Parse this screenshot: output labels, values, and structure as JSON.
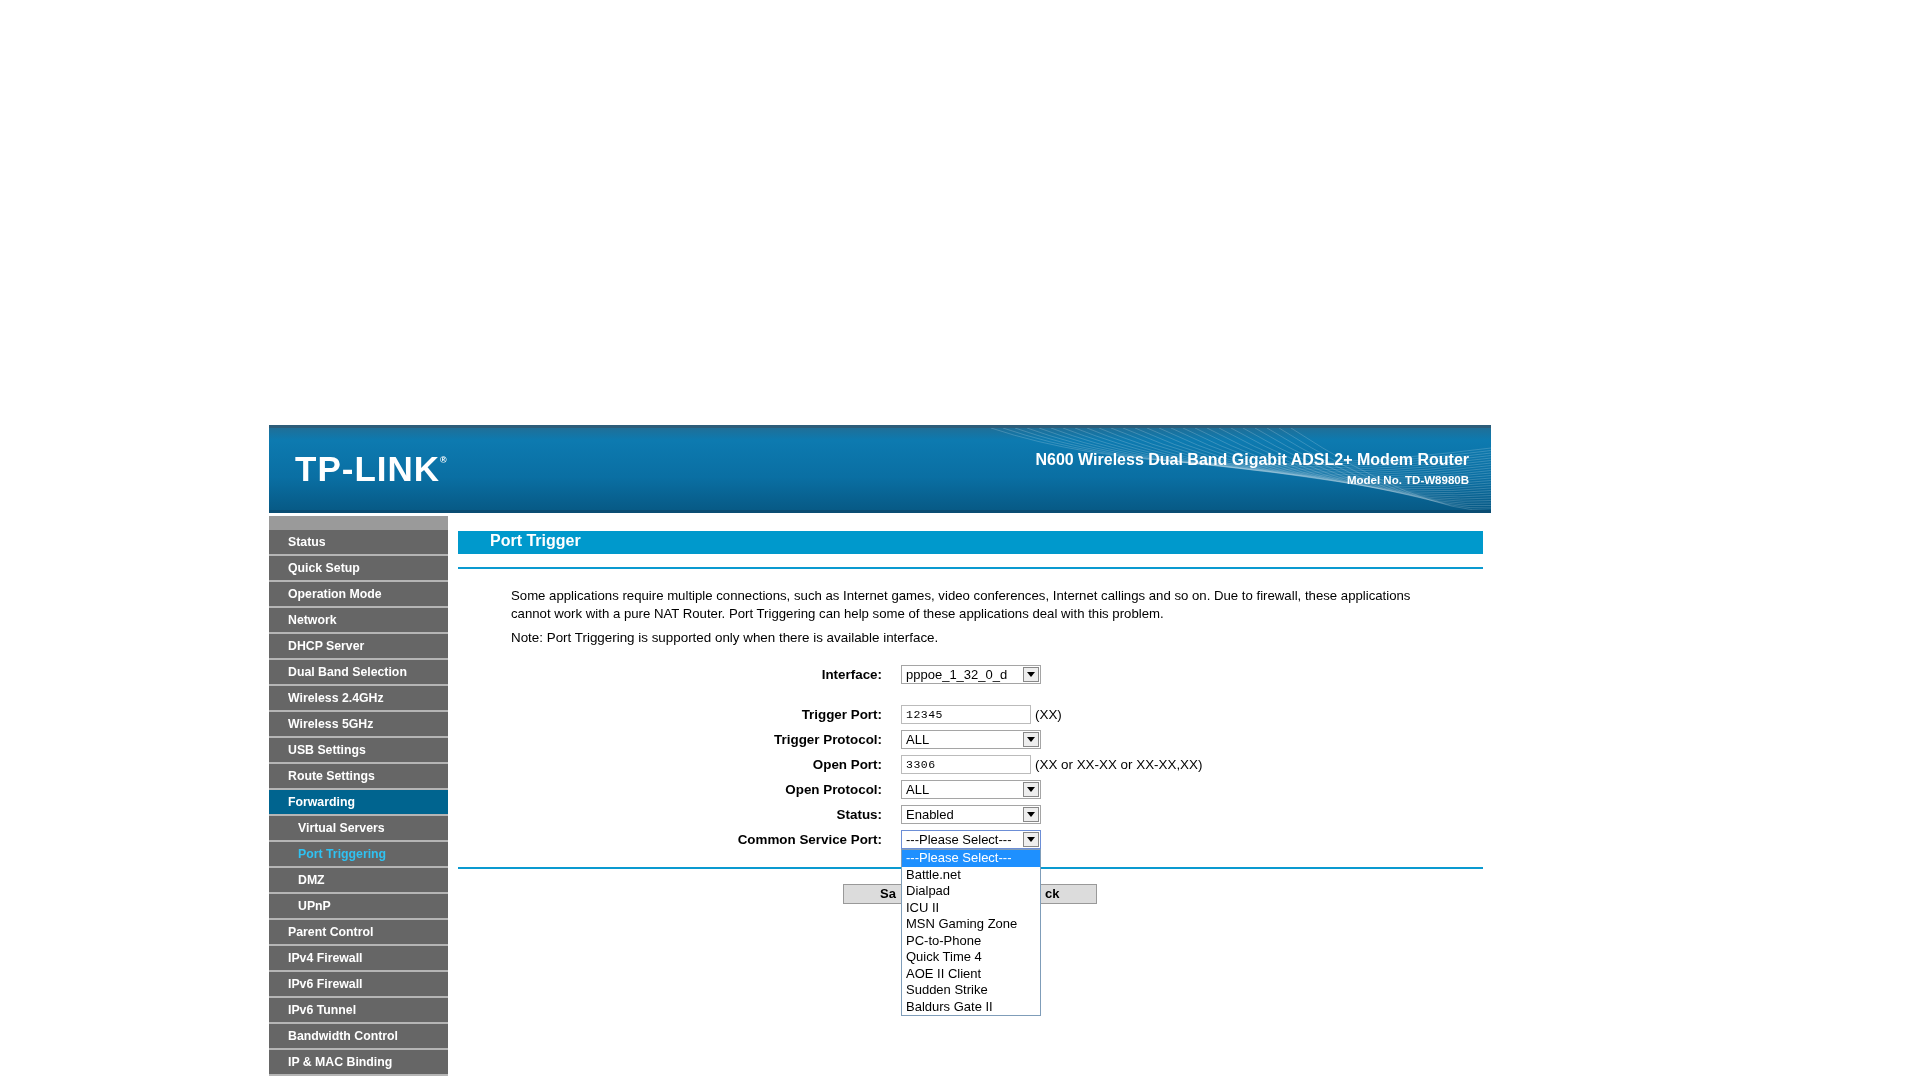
{
  "header": {
    "logo": "TP-LINK$^{®}$",
    "product": "N600 Wireless Dual Band Gigabit ADSL2+ Modem Router",
    "model": "Model No. TD-W8980B"
  },
  "sidebar": {
    "items": [
      {
        "label": "Status",
        "selected": false
      },
      {
        "label": "Quick Setup",
        "selected": false
      },
      {
        "label": "Operation Mode",
        "selected": false
      },
      {
        "label": "Network",
        "selected": false
      },
      {
        "label": "DHCP Server",
        "selected": false
      },
      {
        "label": "Dual Band Selection",
        "selected": false
      },
      {
        "label": "Wireless 2.4GHz",
        "selected": false
      },
      {
        "label": "Wireless 5GHz",
        "selected": false
      },
      {
        "label": "USB Settings",
        "selected": false
      },
      {
        "label": "Route Settings",
        "selected": false
      },
      {
        "label": "Forwarding",
        "selected": true,
        "children": [
          {
            "label": "Virtual Servers",
            "selected": false
          },
          {
            "label": "Port Triggering",
            "selected": true
          },
          {
            "label": "DMZ",
            "selected": false
          },
          {
            "label": "UPnP",
            "selected": false
          }
        ]
      },
      {
        "label": "Parent Control",
        "selected": false
      },
      {
        "label": "IPv4 Firewall",
        "selected": false
      },
      {
        "label": "IPv6 Firewall",
        "selected": false
      },
      {
        "label": "IPv6 Tunnel",
        "selected": false
      },
      {
        "label": "Bandwidth Control",
        "selected": false
      },
      {
        "label": "IP & MAC Binding",
        "selected": false
      }
    ]
  },
  "page": {
    "title": "Port Trigger",
    "description": "Some applications require multiple connections, such as Internet games, video conferences, Internet callings and so on. Due to firewall, these applications cannot work with a pure NAT Router. Port Triggering can help some of these applications deal with this problem.",
    "note": "Note: Port Triggering is supported only when there is available interface."
  },
  "form": {
    "fields": [
      {
        "kind": "select",
        "label": "Interface:",
        "value": "pppoe_1_32_0_d",
        "expanded": false
      },
      {
        "kind": "text",
        "label": "Trigger Port:",
        "value": "12345",
        "hint": "(XX)"
      },
      {
        "kind": "select",
        "label": "Trigger Protocol:",
        "value": "ALL",
        "expanded": false
      },
      {
        "kind": "text",
        "label": "Open Port:",
        "value": "3306",
        "hint": "(XX or XX-XX or XX-XX,XX)"
      },
      {
        "kind": "select",
        "label": "Open Protocol:",
        "value": "ALL",
        "expanded": false
      },
      {
        "kind": "select",
        "label": "Status:",
        "value": "Enabled",
        "expanded": false
      },
      {
        "kind": "select",
        "label": "Common Service Port:",
        "value": "---Please Select---",
        "expanded": true,
        "options": [
          {
            "label": "---Please Select---",
            "selected": true
          },
          {
            "label": "Battle.net",
            "selected": false
          },
          {
            "label": "Dialpad",
            "selected": false
          },
          {
            "label": "ICU II",
            "selected": false
          },
          {
            "label": "MSN Gaming Zone",
            "selected": false
          },
          {
            "label": "PC-to-Phone",
            "selected": false
          },
          {
            "label": "Quick Time 4",
            "selected": false
          },
          {
            "label": "AOE II Client",
            "selected": false
          },
          {
            "label": "Sudden Strike",
            "selected": false
          },
          {
            "label": "Baldurs Gate II",
            "selected": false
          }
        ]
      }
    ]
  },
  "buttons": [
    "Sa",
    "ck"
  ]
}
